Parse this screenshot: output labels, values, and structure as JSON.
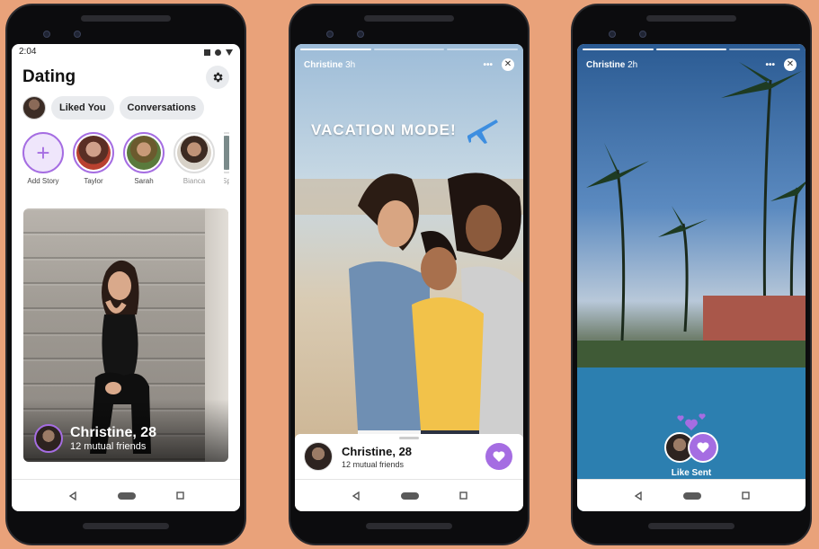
{
  "phone1": {
    "status": {
      "time": "2:04"
    },
    "header": {
      "title": "Dating"
    },
    "pills": [
      "Liked You",
      "Conversations"
    ],
    "stories": [
      {
        "name": "Add Story"
      },
      {
        "name": "Taylor"
      },
      {
        "name": "Sarah"
      },
      {
        "name": "Bianca"
      },
      {
        "name": "Sp"
      }
    ],
    "card": {
      "name": "Christine, 28",
      "mutual": "12 mutual friends"
    }
  },
  "phone2": {
    "story_author": "Christine",
    "story_time": "3h",
    "overlay_text": "VACATION MODE!",
    "card": {
      "name": "Christine, 28",
      "mutual": "12 mutual friends"
    }
  },
  "phone3": {
    "story_author": "Christine",
    "story_time": "2h",
    "like_label": "Like Sent"
  },
  "colors": {
    "accent": "#a56de2",
    "background": "#E9A27A"
  }
}
